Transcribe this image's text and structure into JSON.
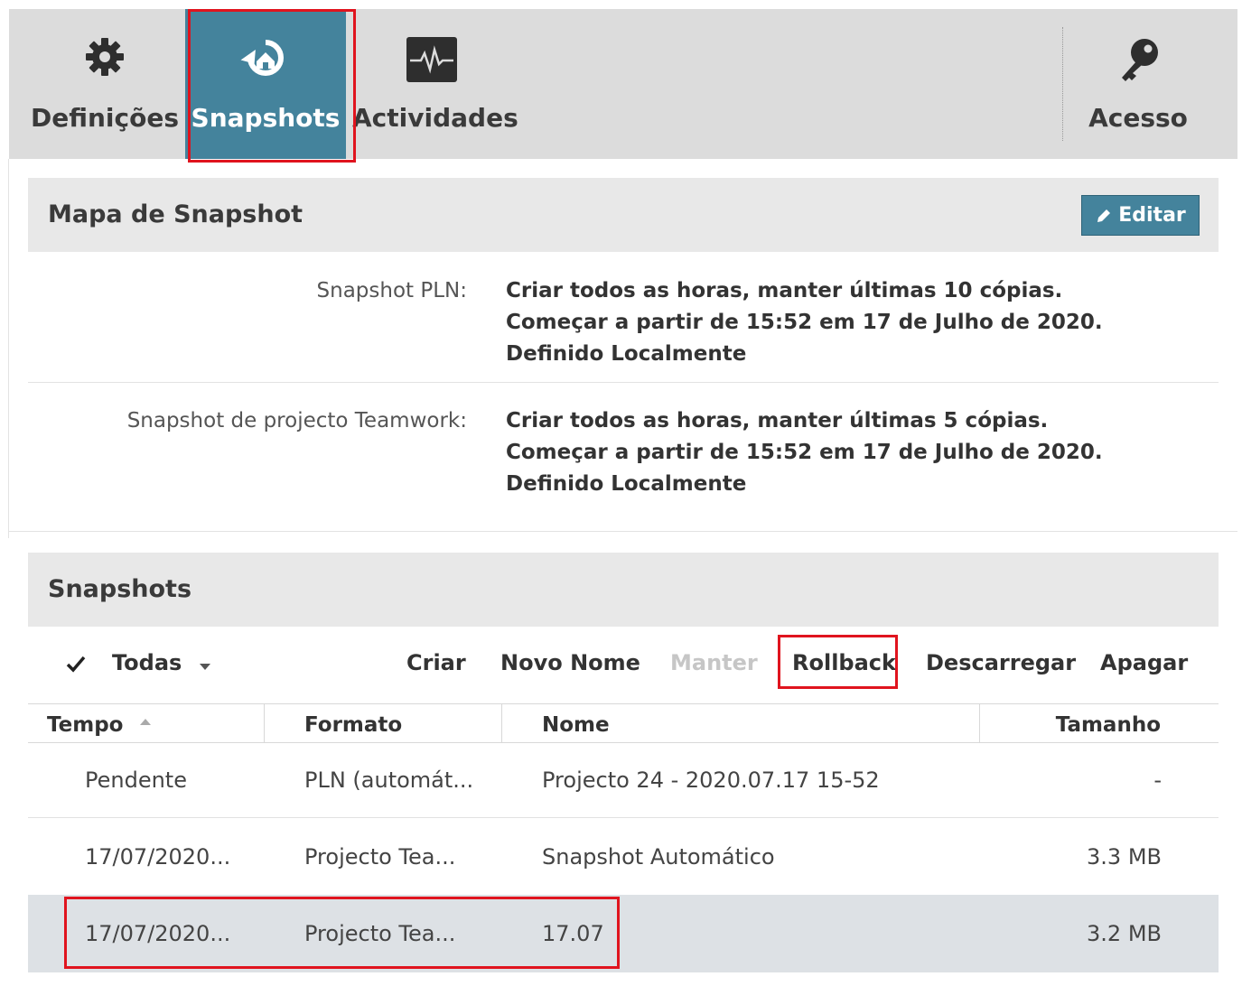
{
  "toolbar": {
    "tabs": [
      {
        "label": "Definições",
        "icon": "gear-icon"
      },
      {
        "label": "Snapshots",
        "icon": "snapshot-restore-icon",
        "active": true
      },
      {
        "label": "Actividades",
        "icon": "activity-monitor-icon"
      }
    ],
    "access": {
      "label": "Acesso",
      "icon": "key-icon"
    },
    "accent_color": "#44839c",
    "highlight_color": "#e0141e"
  },
  "snapshot_map": {
    "title": "Mapa de Snapshot",
    "edit_label": "Editar",
    "rows": [
      {
        "key": "Snapshot PLN:",
        "lines": [
          "Criar todos as horas, manter últimas 10 cópias.",
          "Começar a partir de 15:52 em 17 de Julho de 2020.",
          "Definido Localmente"
        ]
      },
      {
        "key": "Snapshot de projecto Teamwork:",
        "lines": [
          "Criar todos as horas, manter últimas 5 cópias.",
          "Começar a partir de 15:52 em 17 de Julho de 2020.",
          "Definido Localmente"
        ]
      }
    ]
  },
  "snapshots": {
    "title": "Snapshots",
    "filter_label": "Todas",
    "actions": {
      "create": "Criar",
      "rename": "Novo Nome",
      "keep": "Manter",
      "rollback": "Rollback",
      "download": "Descarregar",
      "delete": "Apagar"
    },
    "columns": {
      "time": "Tempo",
      "format": "Formato",
      "name": "Nome",
      "size": "Tamanho"
    },
    "rows": [
      {
        "time": "Pendente",
        "format": "PLN (automát...",
        "name": "Projecto 24 - 2020.07.17 15-52",
        "size": "-"
      },
      {
        "time": "17/07/2020...",
        "format": "Projecto Tea...",
        "name": "Snapshot Automático",
        "size": "3.3 MB"
      },
      {
        "time": "17/07/2020...",
        "format": "Projecto Tea...",
        "name": "17.07",
        "size": "3.2 MB",
        "selected": true
      }
    ]
  }
}
